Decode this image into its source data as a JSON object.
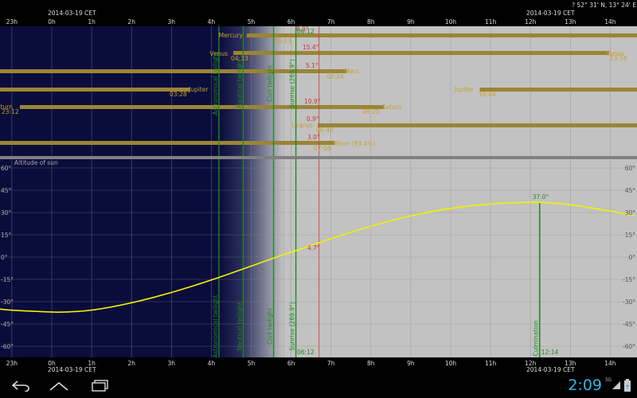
{
  "header": {
    "date_left": "2014-03-19 CET",
    "date_right": "2014-03-19 CET",
    "location": "? 52° 31' N, 13° 24' E"
  },
  "footer": {
    "date_left": "2014-03-19 CET",
    "date_right": "2014-03-19 CET"
  },
  "hour_labels": [
    "23h",
    "0h",
    "1h",
    "2h",
    "3h",
    "4h",
    "5h",
    "6h",
    "7h",
    "8h",
    "9h",
    "10h",
    "11h",
    "12h",
    "13h",
    "14h"
  ],
  "planets": [
    {
      "name": "Mercury",
      "label": "Mercury",
      "time": "05:33",
      "alt": "8.9°",
      "alt_val": 8.9,
      "rise": 5.55,
      "set": null,
      "peak_pct": null
    },
    {
      "name": "Venus",
      "label": "Venus",
      "time": "04:33",
      "alt": "15.4°",
      "alt_val": 15.4,
      "rise": 4.55,
      "set": 13.97,
      "set_time": "13:58",
      "peak_pct": null
    },
    {
      "name": "Mars",
      "label": "Mars",
      "time": "07:24",
      "alt": "5.1°",
      "alt_val": 5.1,
      "rise": null,
      "set": 7.4,
      "peak_pct": null
    },
    {
      "name": "Jupiter",
      "label": "Jupiter",
      "time": "03:28",
      "alt": "",
      "rise": null,
      "set": 3.47,
      "rise2": 10.73,
      "rise2_time": "10:44",
      "peak_pct": null
    },
    {
      "name": "Saturn",
      "label": "Saturn",
      "time": "23:12",
      "alt": "10.9°",
      "alt_val": 10.9,
      "rise": 23.2,
      "set": 8.33,
      "set_time": "08:20",
      "peak_pct": null
    },
    {
      "name": "Uranus",
      "label": "Uranus",
      "time": "06:40",
      "alt": "0.9°",
      "alt_val": 0.9,
      "rise": 6.67,
      "set": null,
      "peak_pct": null
    },
    {
      "name": "Moon",
      "label": "Moon (93.4%)",
      "time": "07:06",
      "alt": "3.0°",
      "alt_val": 3.0,
      "rise": null,
      "set": 7.1,
      "peak_pct": 93.4
    }
  ],
  "twilight": {
    "astronomical": "Astronomical twilight",
    "nautical": "Nautical twilight",
    "civil": "Civil twilight",
    "sunrise": "Sunrise (269.9°)",
    "sunrise_time": "06:12",
    "sunrise_top_time": "06:12",
    "culmination": "Culmination",
    "culmination_time": "12:14",
    "culmination_alt": "37.0°",
    "current_alt": "4.7°"
  },
  "altitude_panel": {
    "title": "Altitude of sun",
    "y_ticks": [
      "60°",
      "45°",
      "30°",
      "15°",
      "0°",
      "-15°",
      "-30°",
      "-45°",
      "-60°"
    ]
  },
  "chart_data": {
    "type": "line",
    "title": "Altitude of sun",
    "xlabel": "",
    "ylabel": "",
    "x_unit": "hour",
    "xlim": [
      22.7,
      14.6
    ],
    "ylim": [
      -67,
      67
    ],
    "series": [
      {
        "x": [
          22.7,
          23,
          0,
          0.3,
          1,
          2,
          3,
          4,
          5,
          6,
          6.2,
          7,
          8,
          9,
          10,
          11,
          12,
          12.23,
          13,
          14,
          14.6
        ],
        "values": [
          -35.0,
          -35.8,
          -37.0,
          -37.1,
          -36.0,
          -31.0,
          -24.0,
          -15.5,
          -6.0,
          3.5,
          5.0,
          12.5,
          21.0,
          28.0,
          33.0,
          36.0,
          37.0,
          37.0,
          35.5,
          31.0,
          28.0
        ]
      }
    ]
  },
  "colors": {
    "night": "#0a0c3c",
    "day": "#c2c2c2",
    "bar": "#9a8535",
    "sun_curve": "#f2f200",
    "twilight_line": "#1f8a1f",
    "current_line": "#cc4444"
  },
  "statusbar": {
    "time": "2:09",
    "network": "3G"
  }
}
